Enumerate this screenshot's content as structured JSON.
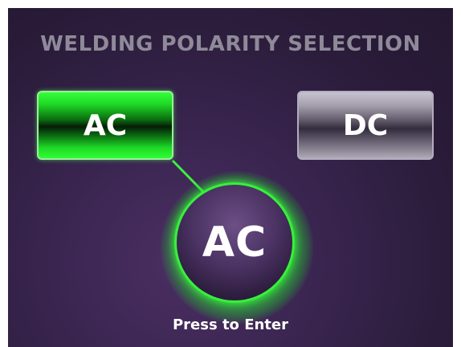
{
  "screen": {
    "title": "WELDING POLARITY SELECTION",
    "options": [
      {
        "label": "AC",
        "selected": true
      },
      {
        "label": "DC",
        "selected": false
      }
    ],
    "knob": {
      "label": "AC"
    },
    "hint": "Press to Enter"
  },
  "colors": {
    "selected_accent": "#22e82a",
    "background": "#2f1f40",
    "title_text": "#8f8a99"
  }
}
